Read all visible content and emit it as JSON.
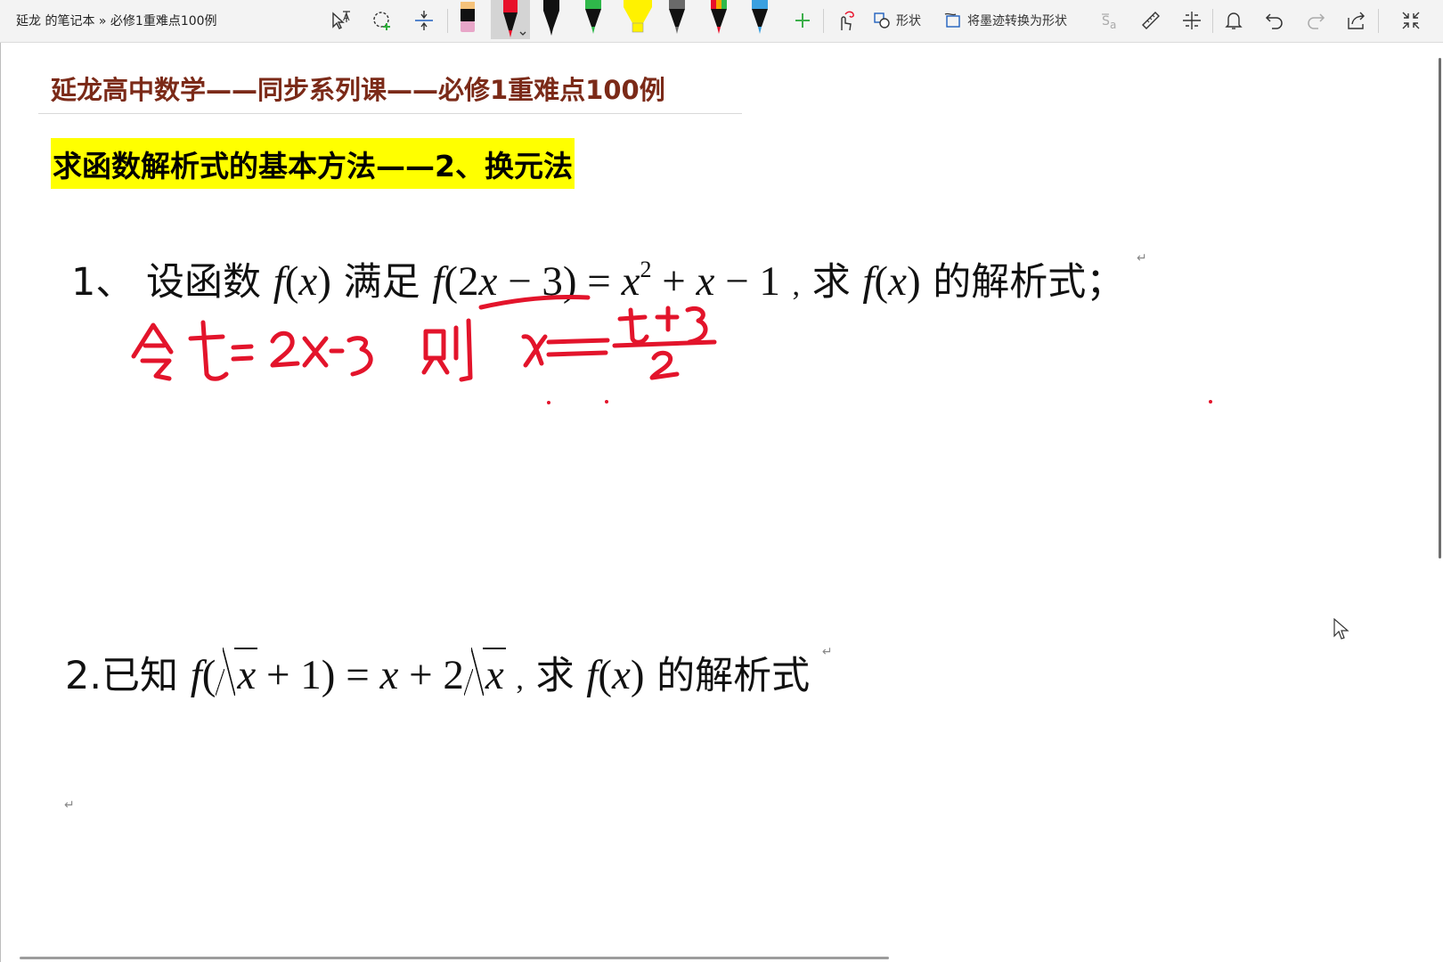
{
  "toolbar": {
    "breadcrumb": "延龙 的笔记本 » 必修1重难点100例",
    "shape_label": "形状",
    "convert_label": "将墨迹转换为形状",
    "icons": [
      "lasso-text-icon",
      "lasso-select-icon",
      "insert-space-icon",
      "touch-draw-icon",
      "ink-to-math-icon",
      "ruler-icon",
      "settings-icon",
      "bell-icon",
      "undo-icon",
      "redo-icon",
      "share-icon",
      "exit-fullscreen-icon"
    ],
    "pen_colors": [
      "#e8a6c8",
      "#e8102a",
      "#111111",
      "#2fb84a",
      "#fff200",
      "#6a6a6a",
      "#e8102a",
      "#3aa0e0"
    ],
    "add_pen_color": "#3cae4a",
    "accent_color": "#1f5fbf"
  },
  "page": {
    "header_title": "延龙高中数学——同步系列课——必修1重难点100例",
    "header_color": "#7b2a18",
    "section_title": "求函数解析式的基本方法——2、换元法",
    "highlight_color": "#ffff00",
    "problem1": {
      "number": "1、",
      "text_a": "设函数",
      "text_b": "满足",
      "text_c": "求",
      "text_d": "的解析式；",
      "para_mark": "↵"
    },
    "problem2": {
      "number": "2.已知",
      "text_c": "求",
      "text_d": "的解析式",
      "para_mark": "↵"
    },
    "trailing_para_mark": "↵",
    "ink_color": "#e3142b"
  }
}
